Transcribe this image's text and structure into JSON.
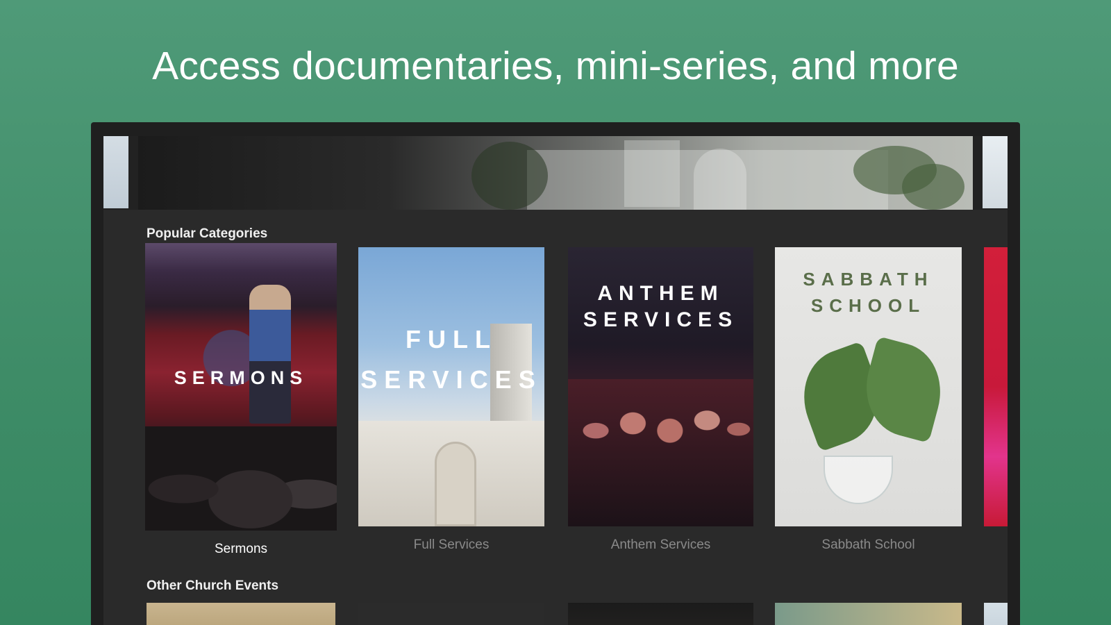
{
  "headline": "Access documentaries, mini-series, and more",
  "sections": {
    "popular": {
      "title": "Popular Categories",
      "cards": [
        {
          "art_text": "SERMONS",
          "caption": "Sermons",
          "focused": true
        },
        {
          "art_text": "FULL SERVICES",
          "caption": "Full Services",
          "focused": false
        },
        {
          "art_text": "ANTHEM SERVICES",
          "caption": "Anthem Services",
          "focused": false
        },
        {
          "art_text": "SABBATH SCHOOL",
          "caption": "Sabbath School",
          "focused": false
        }
      ]
    },
    "other": {
      "title": "Other Church Events"
    }
  },
  "colors": {
    "background": "#4a9672",
    "tv_frame": "#1f1f1f",
    "screen": "#2a2a2a",
    "caption_focused": "#ffffff",
    "caption_dim": "#8a8a8a",
    "sabbath_text": "#5a6e4a"
  }
}
